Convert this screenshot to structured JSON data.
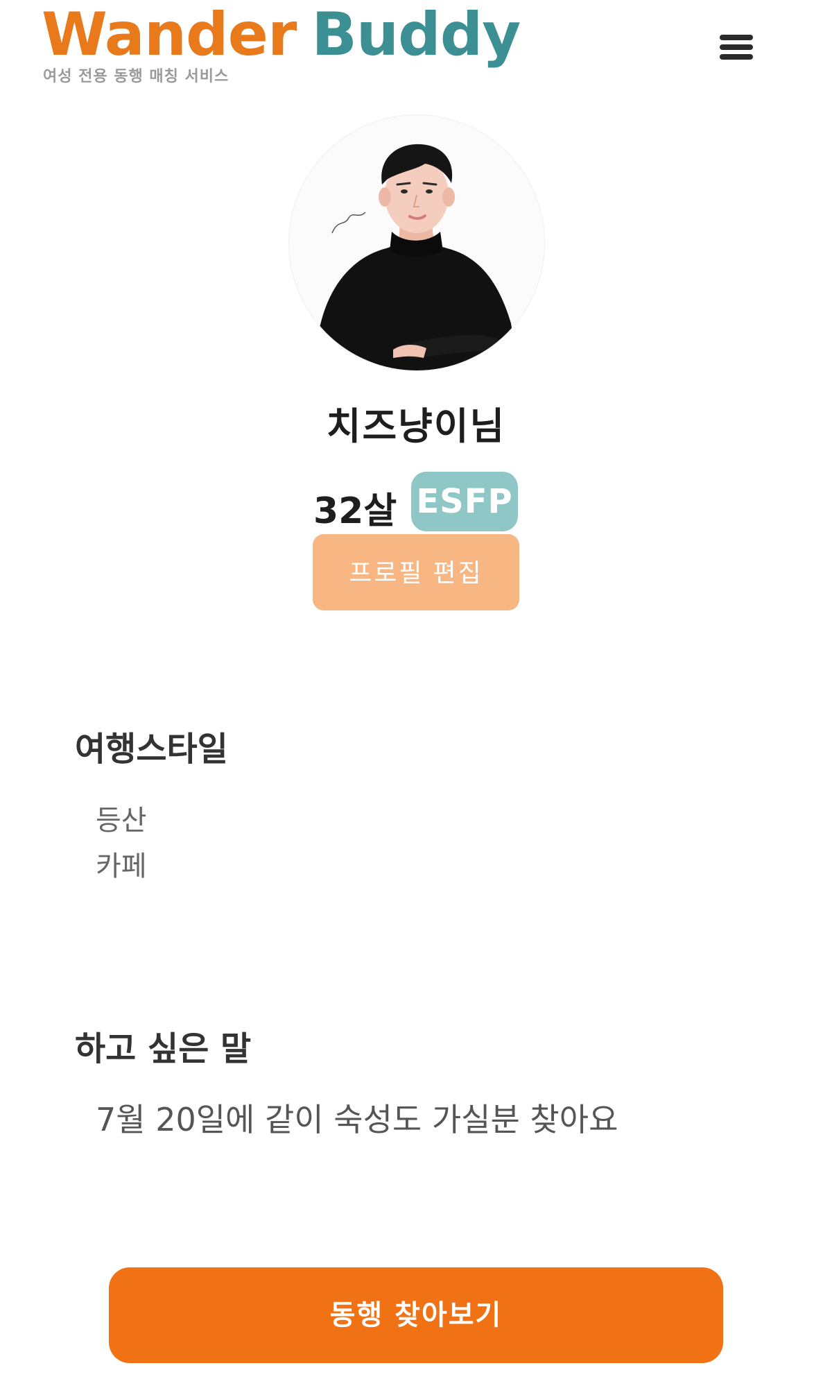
{
  "header": {
    "logo_word1": "Wander",
    "logo_word2": "Buddy",
    "tagline": "여성 전용 동행 매칭 서비스",
    "menu_icon": "hamburger-menu-icon"
  },
  "profile": {
    "nickname": "치즈냥이님",
    "age": "32살",
    "mbti": "ESFP",
    "edit_label": "프로필 편집"
  },
  "travel_style": {
    "title": "여행스타일",
    "items": [
      "등산",
      "카페"
    ]
  },
  "message_section": {
    "title": "하고 싶은 말",
    "text": "7월 20일에 같이 숙성도 가실분 찾아요"
  },
  "cta": {
    "label": "동행 찾아보기"
  },
  "colors": {
    "brand_orange": "#E97A1C",
    "brand_teal": "#3C8F92",
    "mbti_badge": "#8FC6C6",
    "edit_button": "#F7B682",
    "cta_button": "#F07214"
  }
}
